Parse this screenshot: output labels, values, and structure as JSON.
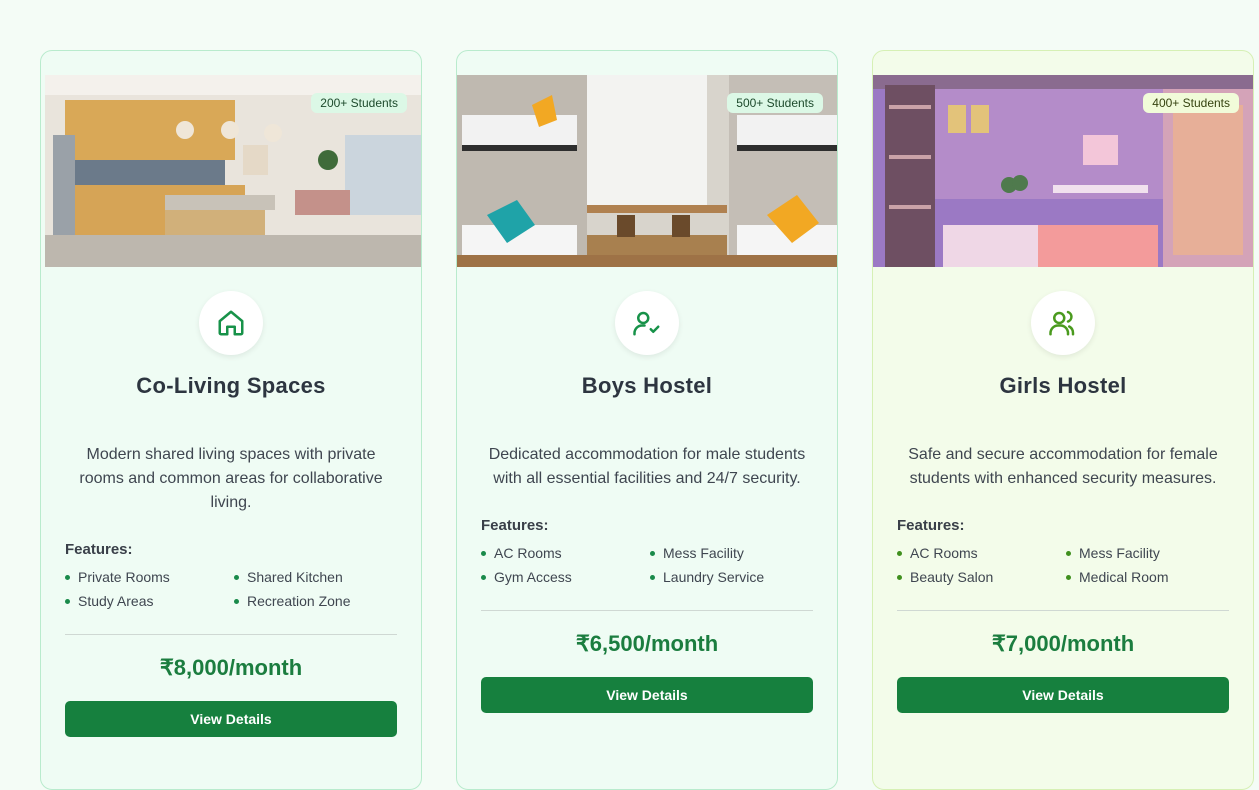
{
  "cards": [
    {
      "badge": "200+ Students",
      "icon": "home-icon",
      "title": "Co-Living Spaces",
      "description": "Modern shared living spaces with private rooms and common areas for collaborative living.",
      "features_heading": "Features:",
      "features": [
        "Private Rooms",
        "Shared Kitchen",
        "Study Areas",
        "Recreation Zone"
      ],
      "price": "₹8,000/month",
      "button": "View Details"
    },
    {
      "badge": "500+ Students",
      "icon": "user-check-icon",
      "title": "Boys Hostel",
      "description": "Dedicated accommodation for male students with all essential facilities and 24/7 security.",
      "features_heading": "Features:",
      "features": [
        "AC Rooms",
        "Mess Facility",
        "Gym Access",
        "Laundry Service"
      ],
      "price": "₹6,500/month",
      "button": "View Details"
    },
    {
      "badge": "400+ Students",
      "icon": "users-icon",
      "title": "Girls Hostel",
      "description": "Safe and secure accommodation for female students with enhanced security measures.",
      "features_heading": "Features:",
      "features": [
        "AC Rooms",
        "Mess Facility",
        "Beauty Salon",
        "Medical Room"
      ],
      "price": "₹7,000/month",
      "button": "View Details"
    }
  ],
  "colors": {
    "accent": "#16803e",
    "price": "#1b7d3f",
    "card_bg": "#effcf4",
    "girls_card_bg": "#f3fcea"
  }
}
